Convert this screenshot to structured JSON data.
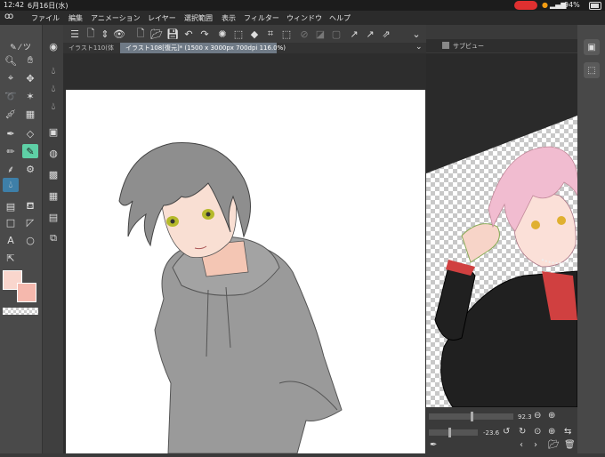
{
  "status": {
    "time": "12:42",
    "date": "6月16日(水)",
    "battery": "94%"
  },
  "menu": [
    "ファイル",
    "編集",
    "アニメーション",
    "レイヤー",
    "選択範囲",
    "表示",
    "フィルター",
    "ウィンドウ",
    "ヘルプ"
  ],
  "tabs": {
    "inactive": "イラスト110(体",
    "active": "イラスト108[復元]* (1500 x 3000px 700dpi 116.0%)"
  },
  "subview": {
    "title": "サブビュー",
    "zoom_value": "92.3",
    "rotate_value": "-23.6"
  },
  "colors": {
    "main_color": "#f9d6cd",
    "sub_color": "#f5b8ad",
    "accent": "#3e7fa8"
  }
}
